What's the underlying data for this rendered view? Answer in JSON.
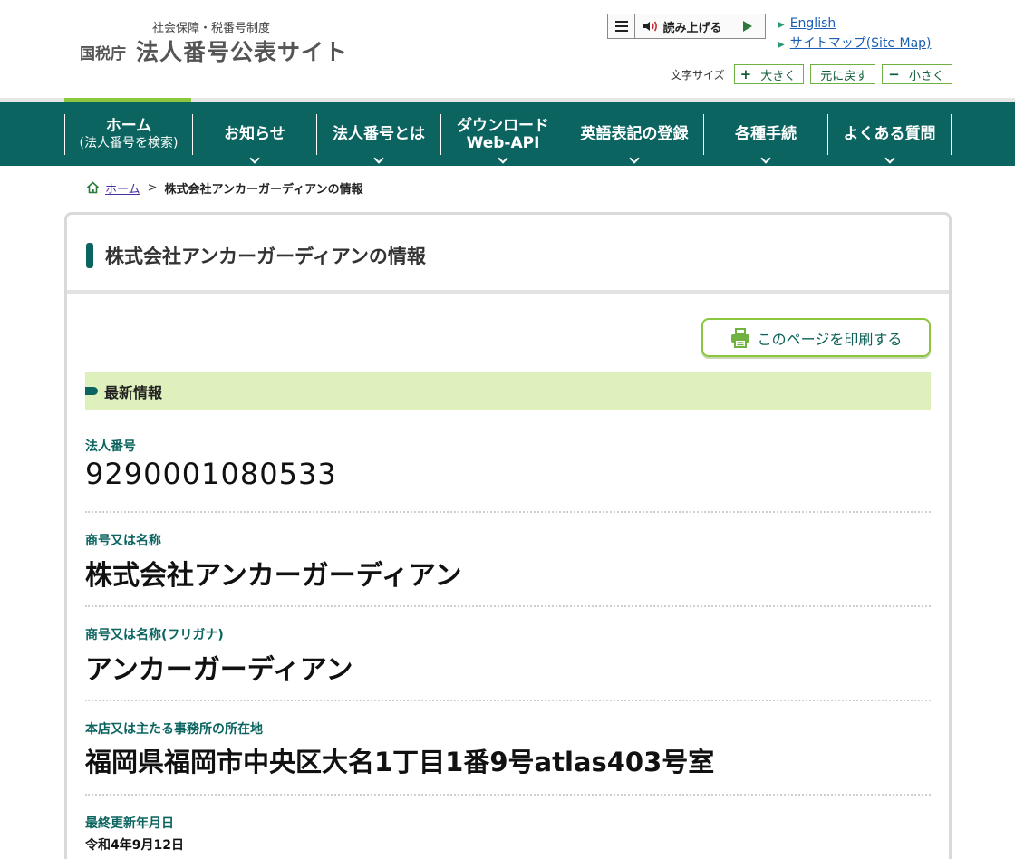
{
  "header": {
    "logo_sub": "社会保障・税番号制度",
    "logo_agency": "国税庁",
    "logo_title": "法人番号公表サイト",
    "read_aloud_label": "読み上げる",
    "links": [
      {
        "label": "English"
      },
      {
        "label": "サイトマップ(Site Map)"
      }
    ],
    "font_size": {
      "label": "文字サイズ",
      "larger": "大きく",
      "reset": "元に戻す",
      "smaller": "小さく"
    }
  },
  "nav": [
    {
      "line1": "ホーム",
      "line2": "(法人番号を検索)",
      "dropdown": false
    },
    {
      "line1": "お知らせ",
      "dropdown": true
    },
    {
      "line1": "法人番号とは",
      "dropdown": true
    },
    {
      "line1": "ダウンロード",
      "line2": "Web-API",
      "dropdown": true
    },
    {
      "line1": "英語表記の登録",
      "dropdown": true
    },
    {
      "line1": "各種手続",
      "dropdown": true
    },
    {
      "line1": "よくある質問",
      "dropdown": true
    }
  ],
  "breadcrumb": {
    "home": "ホーム",
    "separator": ">",
    "current": "株式会社アンカーガーディアンの情報"
  },
  "page": {
    "title": "株式会社アンカーガーディアンの情報",
    "print_button": "このページを印刷する",
    "section_title": "最新情報"
  },
  "fields": [
    {
      "label": "法人番号",
      "value": "9290001080533"
    },
    {
      "label": "商号又は名称",
      "value": "株式会社アンカーガーディアン"
    },
    {
      "label": "商号又は名称(フリガナ)",
      "value": "アンカーガーディアン"
    },
    {
      "label": "本店又は主たる事務所の所在地",
      "value": "福岡県福岡市中央区大名1丁目1番9号atlas403号室"
    },
    {
      "label": "最終更新年月日",
      "value": "令和4年9月12日"
    }
  ],
  "colors": {
    "nav_background": "#0b6460",
    "accent_green": "#8cc63f",
    "section_band": "#def1bd",
    "label_teal": "#0b6460",
    "link_blue": "#1a5fb4"
  }
}
